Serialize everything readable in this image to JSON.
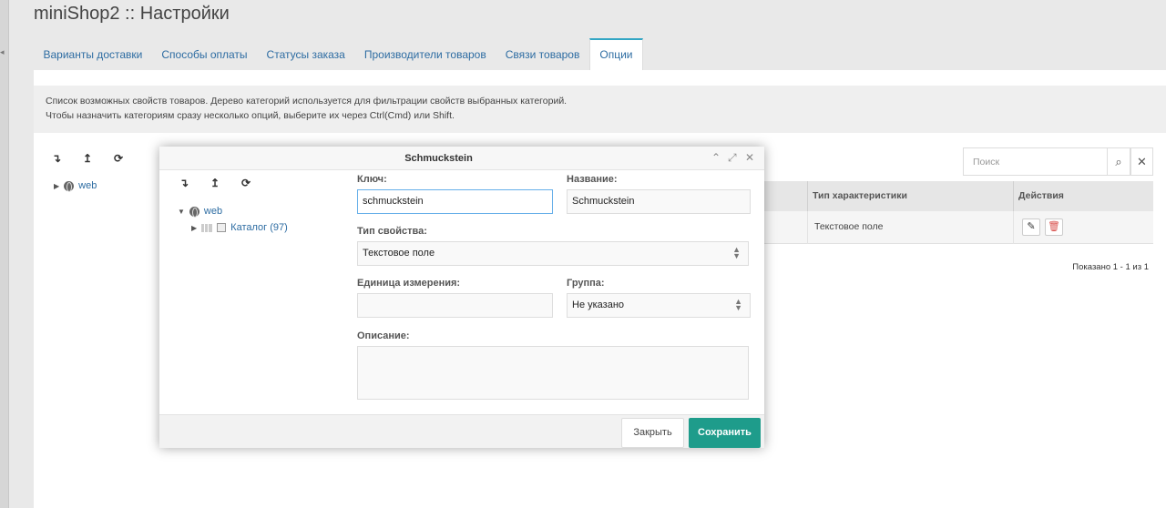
{
  "app": {
    "title": "miniShop2 :: Настройки"
  },
  "tabs": [
    {
      "label": "Варианты доставки"
    },
    {
      "label": "Способы оплаты"
    },
    {
      "label": "Статусы заказа"
    },
    {
      "label": "Производители товаров"
    },
    {
      "label": "Связи товаров"
    },
    {
      "label": "Опции",
      "active": true
    }
  ],
  "info": {
    "line1": "Список возможных свойств товаров. Дерево категорий используется для фильтрации свойств выбранных категорий.",
    "line2": "Чтобы назначить категориям сразу несколько опций, выберите их через Ctrl(Cmd) или Shift."
  },
  "tree": {
    "toolbar": {
      "expand": "↴",
      "collapse": "↥",
      "refresh": "⟳"
    },
    "root": "web"
  },
  "search": {
    "placeholder": "Поиск",
    "search_icon": "⌕",
    "clear_icon": "✕"
  },
  "grid": {
    "columns": [
      "Тип характеристики",
      "Действия"
    ],
    "rows": [
      {
        "type": "Текстовое поле"
      }
    ],
    "pager": "Показано 1 - 1 из 1"
  },
  "modal": {
    "title": "Schmuckstein",
    "tree": {
      "root": "web",
      "child": "Каталог (97)"
    },
    "key": {
      "label": "Ключ:",
      "value": "schmuckstein"
    },
    "name": {
      "label": "Название:",
      "value": "Schmuckstein"
    },
    "prop_type": {
      "label": "Тип свойства:",
      "value": "Текстовое поле"
    },
    "unit": {
      "label": "Единица измерения:",
      "value": ""
    },
    "group": {
      "label": "Группа:",
      "value": "Не указано"
    },
    "description": {
      "label": "Описание:",
      "value": ""
    },
    "buttons": {
      "close": "Закрыть",
      "save": "Сохранить"
    }
  }
}
